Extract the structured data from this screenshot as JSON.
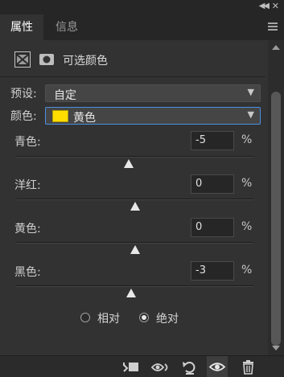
{
  "tabs": [
    {
      "label": "属性"
    },
    {
      "label": "信息"
    }
  ],
  "panel": {
    "adjustment_title": "可选颜色"
  },
  "preset": {
    "label": "预设:",
    "value": "自定"
  },
  "colors": {
    "label": "颜色:",
    "value": "黄色",
    "swatch_color": "#FFDD00"
  },
  "sliders": [
    {
      "label": "青色:",
      "value": "-5",
      "unit": "%",
      "level_percent": -5
    },
    {
      "label": "洋红:",
      "value": "0",
      "unit": "%",
      "level_percent": 0
    },
    {
      "label": "黄色:",
      "value": "0",
      "unit": "%",
      "level_percent": 0
    },
    {
      "label": "黑色:",
      "value": "-3",
      "unit": "%",
      "level_percent": -3
    }
  ],
  "method": {
    "options": [
      {
        "label": "相对",
        "checked": false
      },
      {
        "label": "绝对",
        "checked": true
      }
    ]
  },
  "bottom_icons": [
    {
      "name": "clip-to-layer-icon"
    },
    {
      "name": "view-previous-state-icon"
    },
    {
      "name": "reset-adjustment-icon"
    },
    {
      "name": "toggle-visibility-icon"
    },
    {
      "name": "trash-icon"
    }
  ],
  "accent_color": "#4A90E2"
}
